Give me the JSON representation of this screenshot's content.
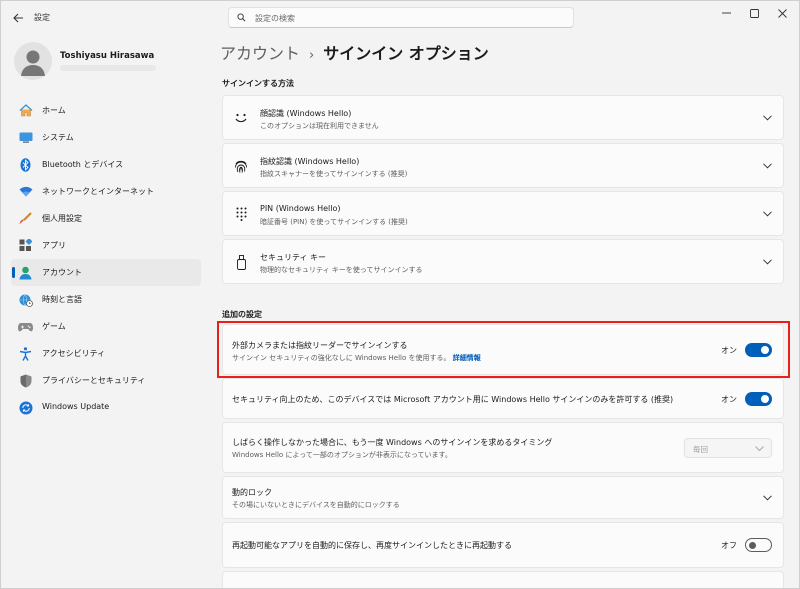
{
  "app": {
    "title": "設定",
    "back_icon": "back-arrow-icon"
  },
  "search": {
    "placeholder": "設定の検索",
    "icon": "search-icon"
  },
  "window_controls": {
    "minimize": "minimize-icon",
    "maximize": "maximize-icon",
    "close": "close-icon"
  },
  "user": {
    "name": "Toshiyasu Hirasawa",
    "avatar": "person-avatar-icon"
  },
  "sidebar": {
    "items": [
      {
        "label": "ホーム",
        "icon": "home-icon",
        "active": false
      },
      {
        "label": "システム",
        "icon": "system-icon",
        "active": false
      },
      {
        "label": "Bluetooth とデバイス",
        "icon": "bluetooth-icon",
        "active": false
      },
      {
        "label": "ネットワークとインターネット",
        "icon": "wifi-icon",
        "active": false
      },
      {
        "label": "個人用設定",
        "icon": "brush-icon",
        "active": false
      },
      {
        "label": "アプリ",
        "icon": "apps-icon",
        "active": false
      },
      {
        "label": "アカウント",
        "icon": "account-icon",
        "active": true
      },
      {
        "label": "時刻と言語",
        "icon": "globe-clock-icon",
        "active": false
      },
      {
        "label": "ゲーム",
        "icon": "gamepad-icon",
        "active": false
      },
      {
        "label": "アクセシビリティ",
        "icon": "accessibility-icon",
        "active": false
      },
      {
        "label": "プライバシーとセキュリティ",
        "icon": "shield-icon",
        "active": false
      },
      {
        "label": "Windows Update",
        "icon": "windows-update-icon",
        "active": false
      }
    ]
  },
  "breadcrumb": {
    "parent": "アカウント",
    "separator": "›",
    "current": "サインイン オプション"
  },
  "signin_methods": {
    "heading": "サインインする方法",
    "items": [
      {
        "title": "顔認識 (Windows Hello)",
        "desc": "このオプションは現在利用できません",
        "icon": "face-icon"
      },
      {
        "title": "指紋認識 (Windows Hello)",
        "desc": "指紋スキャナーを使ってサインインする (推奨)",
        "icon": "fingerprint-icon"
      },
      {
        "title": "PIN (Windows Hello)",
        "desc": "暗証番号 (PIN) を使ってサインインする (推奨)",
        "icon": "pin-keypad-icon"
      },
      {
        "title": "セキュリティ キー",
        "desc": "物理的なセキュリティ キーを使ってサインインする",
        "icon": "usb-key-icon"
      }
    ]
  },
  "additional": {
    "heading": "追加の設定",
    "external_camera": {
      "title": "外部カメラまたは指紋リーダーでサインインする",
      "desc": "サインイン セキュリティの強化なしに Windows Hello を使用する。",
      "link": "詳細情報",
      "state_label": "オン",
      "on": true
    },
    "hello_only": {
      "title": "セキュリティ向上のため、このデバイスでは Microsoft アカウント用に Windows Hello サインインのみを許可する (推奨)",
      "state_label": "オン",
      "on": true
    },
    "require_signin": {
      "title": "しばらく操作しなかった場合に、もう一度 Windows へのサインインを求めるタイミング",
      "desc": "Windows Hello によって一部のオプションが非表示になっています。",
      "value": "毎回"
    },
    "dynamic_lock": {
      "title": "動的ロック",
      "desc": "その場にいないときにデバイスを自動的にロックする"
    },
    "restart_apps": {
      "title": "再起動可能なアプリを自動的に保存し、再度サインインしたときに再起動する",
      "state_label": "オフ",
      "on": false
    }
  },
  "colors": {
    "accent": "#005fb8",
    "highlight": "#e8201c"
  }
}
